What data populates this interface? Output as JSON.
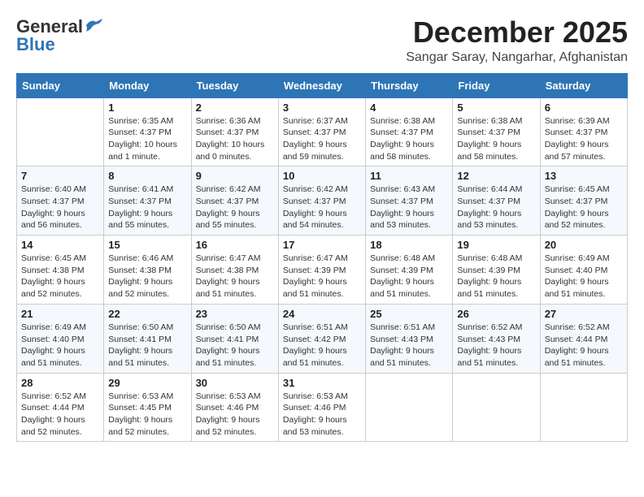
{
  "header": {
    "logo": {
      "line1": "General",
      "line2": "Blue"
    },
    "month": "December 2025",
    "location": "Sangar Saray, Nangarhar, Afghanistan"
  },
  "weekdays": [
    "Sunday",
    "Monday",
    "Tuesday",
    "Wednesday",
    "Thursday",
    "Friday",
    "Saturday"
  ],
  "weeks": [
    [
      {
        "day": "",
        "info": ""
      },
      {
        "day": "1",
        "info": "Sunrise: 6:35 AM\nSunset: 4:37 PM\nDaylight: 10 hours\nand 1 minute."
      },
      {
        "day": "2",
        "info": "Sunrise: 6:36 AM\nSunset: 4:37 PM\nDaylight: 10 hours\nand 0 minutes."
      },
      {
        "day": "3",
        "info": "Sunrise: 6:37 AM\nSunset: 4:37 PM\nDaylight: 9 hours\nand 59 minutes."
      },
      {
        "day": "4",
        "info": "Sunrise: 6:38 AM\nSunset: 4:37 PM\nDaylight: 9 hours\nand 58 minutes."
      },
      {
        "day": "5",
        "info": "Sunrise: 6:38 AM\nSunset: 4:37 PM\nDaylight: 9 hours\nand 58 minutes."
      },
      {
        "day": "6",
        "info": "Sunrise: 6:39 AM\nSunset: 4:37 PM\nDaylight: 9 hours\nand 57 minutes."
      }
    ],
    [
      {
        "day": "7",
        "info": "Sunrise: 6:40 AM\nSunset: 4:37 PM\nDaylight: 9 hours\nand 56 minutes."
      },
      {
        "day": "8",
        "info": "Sunrise: 6:41 AM\nSunset: 4:37 PM\nDaylight: 9 hours\nand 55 minutes."
      },
      {
        "day": "9",
        "info": "Sunrise: 6:42 AM\nSunset: 4:37 PM\nDaylight: 9 hours\nand 55 minutes."
      },
      {
        "day": "10",
        "info": "Sunrise: 6:42 AM\nSunset: 4:37 PM\nDaylight: 9 hours\nand 54 minutes."
      },
      {
        "day": "11",
        "info": "Sunrise: 6:43 AM\nSunset: 4:37 PM\nDaylight: 9 hours\nand 53 minutes."
      },
      {
        "day": "12",
        "info": "Sunrise: 6:44 AM\nSunset: 4:37 PM\nDaylight: 9 hours\nand 53 minutes."
      },
      {
        "day": "13",
        "info": "Sunrise: 6:45 AM\nSunset: 4:37 PM\nDaylight: 9 hours\nand 52 minutes."
      }
    ],
    [
      {
        "day": "14",
        "info": "Sunrise: 6:45 AM\nSunset: 4:38 PM\nDaylight: 9 hours\nand 52 minutes."
      },
      {
        "day": "15",
        "info": "Sunrise: 6:46 AM\nSunset: 4:38 PM\nDaylight: 9 hours\nand 52 minutes."
      },
      {
        "day": "16",
        "info": "Sunrise: 6:47 AM\nSunset: 4:38 PM\nDaylight: 9 hours\nand 51 minutes."
      },
      {
        "day": "17",
        "info": "Sunrise: 6:47 AM\nSunset: 4:39 PM\nDaylight: 9 hours\nand 51 minutes."
      },
      {
        "day": "18",
        "info": "Sunrise: 6:48 AM\nSunset: 4:39 PM\nDaylight: 9 hours\nand 51 minutes."
      },
      {
        "day": "19",
        "info": "Sunrise: 6:48 AM\nSunset: 4:39 PM\nDaylight: 9 hours\nand 51 minutes."
      },
      {
        "day": "20",
        "info": "Sunrise: 6:49 AM\nSunset: 4:40 PM\nDaylight: 9 hours\nand 51 minutes."
      }
    ],
    [
      {
        "day": "21",
        "info": "Sunrise: 6:49 AM\nSunset: 4:40 PM\nDaylight: 9 hours\nand 51 minutes."
      },
      {
        "day": "22",
        "info": "Sunrise: 6:50 AM\nSunset: 4:41 PM\nDaylight: 9 hours\nand 51 minutes."
      },
      {
        "day": "23",
        "info": "Sunrise: 6:50 AM\nSunset: 4:41 PM\nDaylight: 9 hours\nand 51 minutes."
      },
      {
        "day": "24",
        "info": "Sunrise: 6:51 AM\nSunset: 4:42 PM\nDaylight: 9 hours\nand 51 minutes."
      },
      {
        "day": "25",
        "info": "Sunrise: 6:51 AM\nSunset: 4:43 PM\nDaylight: 9 hours\nand 51 minutes."
      },
      {
        "day": "26",
        "info": "Sunrise: 6:52 AM\nSunset: 4:43 PM\nDaylight: 9 hours\nand 51 minutes."
      },
      {
        "day": "27",
        "info": "Sunrise: 6:52 AM\nSunset: 4:44 PM\nDaylight: 9 hours\nand 51 minutes."
      }
    ],
    [
      {
        "day": "28",
        "info": "Sunrise: 6:52 AM\nSunset: 4:44 PM\nDaylight: 9 hours\nand 52 minutes."
      },
      {
        "day": "29",
        "info": "Sunrise: 6:53 AM\nSunset: 4:45 PM\nDaylight: 9 hours\nand 52 minutes."
      },
      {
        "day": "30",
        "info": "Sunrise: 6:53 AM\nSunset: 4:46 PM\nDaylight: 9 hours\nand 52 minutes."
      },
      {
        "day": "31",
        "info": "Sunrise: 6:53 AM\nSunset: 4:46 PM\nDaylight: 9 hours\nand 53 minutes."
      },
      {
        "day": "",
        "info": ""
      },
      {
        "day": "",
        "info": ""
      },
      {
        "day": "",
        "info": ""
      }
    ]
  ]
}
